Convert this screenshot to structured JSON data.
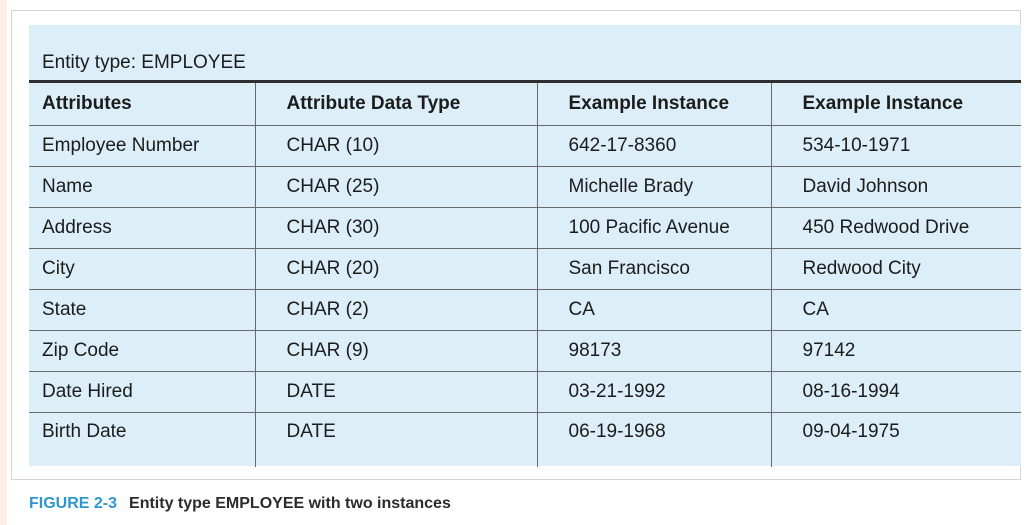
{
  "entity_label": "Entity type: EMPLOYEE",
  "columns": [
    "Attributes",
    "Attribute Data Type",
    "Example Instance",
    "Example Instance"
  ],
  "rows": [
    [
      "Employee Number",
      "CHAR (10)",
      "642-17-8360",
      "534-10-1971"
    ],
    [
      "Name",
      "CHAR (25)",
      "Michelle Brady",
      "David Johnson"
    ],
    [
      "Address",
      "CHAR (30)",
      "100 Pacific Avenue",
      "450 Redwood Drive"
    ],
    [
      "City",
      "CHAR (20)",
      "San Francisco",
      "Redwood City"
    ],
    [
      "State",
      "CHAR (2)",
      "CA",
      "CA"
    ],
    [
      "Zip Code",
      "CHAR (9)",
      "98173",
      "97142"
    ],
    [
      "Date Hired",
      "DATE",
      "03-21-1992",
      "08-16-1994"
    ],
    [
      "Birth Date",
      "DATE",
      "06-19-1968",
      "09-04-1975"
    ]
  ],
  "caption": {
    "number": "FIGURE 2-3",
    "text": "Entity type EMPLOYEE with two instances"
  },
  "colors": {
    "panel_background": "#dceef8",
    "caption_accent": "#2f97cf"
  }
}
